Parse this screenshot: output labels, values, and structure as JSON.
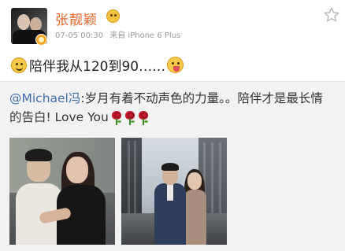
{
  "post": {
    "username": "张靓颖",
    "date": "07-05 00:30",
    "source": "来自 iPhone 6 Plus",
    "text": "陪伴我从120到90……",
    "emoji_start": "smile-emoji",
    "emoji_end": "tongue-emoji"
  },
  "repost": {
    "mention": "@Michael冯",
    "text": ":岁月有着不动声色的力量。。陪伴才是最长情的告白! Love You",
    "emojis": [
      "rose-icon",
      "rose-icon",
      "rose-icon"
    ]
  },
  "colors": {
    "username": "#e8672a",
    "mention": "#3d6ea8",
    "repost_bg": "#f2f2f2",
    "meta": "#9a9a9a"
  }
}
